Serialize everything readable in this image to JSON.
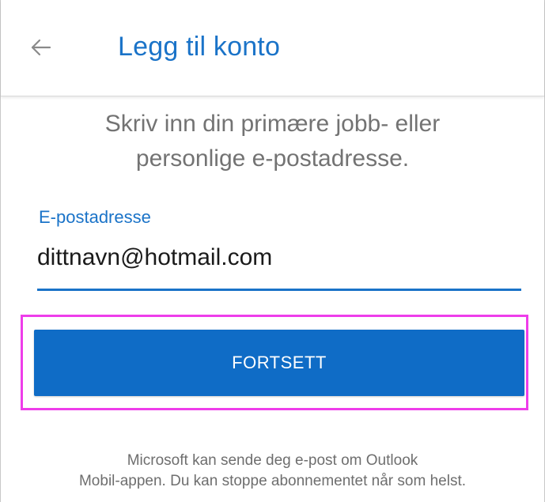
{
  "header": {
    "back_icon": "arrow-left-icon",
    "title": "Legg til konto"
  },
  "instruction": {
    "line1": "Skriv inn din primære jobb- eller",
    "line2": "personlige e-postadresse."
  },
  "email_field": {
    "label": "E-postadresse",
    "value": "dittnavn@hotmail.com"
  },
  "continue_button": {
    "label": "FORTSETT"
  },
  "footer": {
    "line1": "Microsoft kan sende deg e-post om Outlook",
    "line2": "Mobil-appen. Du kan stoppe abonnementet når som helst."
  },
  "colors": {
    "accent": "#1a73c8",
    "button": "#0f6cc6",
    "highlight": "#ee3dea"
  }
}
